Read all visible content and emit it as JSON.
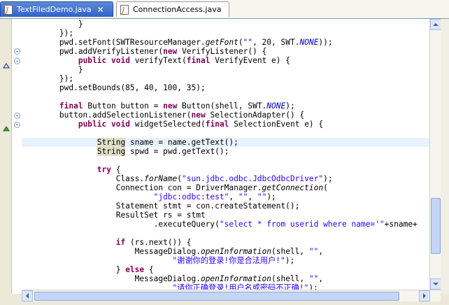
{
  "tabs": [
    {
      "label": "TextFiledDemo.java",
      "active": true,
      "close": "✕",
      "icon": "java-file-icon"
    },
    {
      "label": "ConnectionAccess.java",
      "active": false,
      "icon": "java-file-icon"
    }
  ],
  "code_lines": [
    "            }",
    "        });",
    "        pwd.setFont(SWTResourceManager.getFont(\"\", 20, SWT.NONE));",
    "        pwd.addVerifyListener(new VerifyListener() {",
    "            public void verifyText(final VerifyEvent e) {",
    "            }",
    "        });",
    "        pwd.setBounds(85, 40, 100, 35);",
    "",
    "        final Button button = new Button(shell, SWT.NONE);",
    "        button.addSelectionListener(new SelectionAdapter() {",
    "            public void widgetSelected(final SelectionEvent e) {",
    "",
    "                String sname = name.getText();",
    "                String spwd = pwd.getText();",
    "",
    "                try {",
    "                    Class.forName(\"sun.jdbc.odbc.JdbcOdbcDriver\");",
    "                    Connection con = DriverManager.getConnection(",
    "                            \"jdbc:odbc:test\", \"\", \"\");",
    "                    Statement stmt = con.createStatement();",
    "                    ResultSet rs = stmt",
    "                            .executeQuery(\"select * from userid where name='\"+sname+",
    "",
    "                    if (rs.next()) {",
    "                        MessageDialog.openInformation(shell, \"\",",
    "                                \"谢谢你的登录!你是合法用户!\");",
    "                    } else {",
    "                        MessageDialog.openInformation(shell, \"\",",
    "                                \"请你正确登录!用户名或密码不正确!\");"
  ],
  "colors": {
    "keyword": "#7f0055",
    "string": "#2a00ff",
    "current_line": "#e8f2fe",
    "tab_active": "#2f64c8"
  },
  "icons": {
    "fold": "fold-collapse-icon",
    "override": "override-arrow-icon",
    "implements": "implements-triangle-icon",
    "scroll_up": "scroll-up-arrow-icon",
    "scroll_down": "scroll-down-arrow-icon",
    "scroll_left": "scroll-left-arrow-icon",
    "scroll_right": "scroll-right-arrow-icon"
  }
}
